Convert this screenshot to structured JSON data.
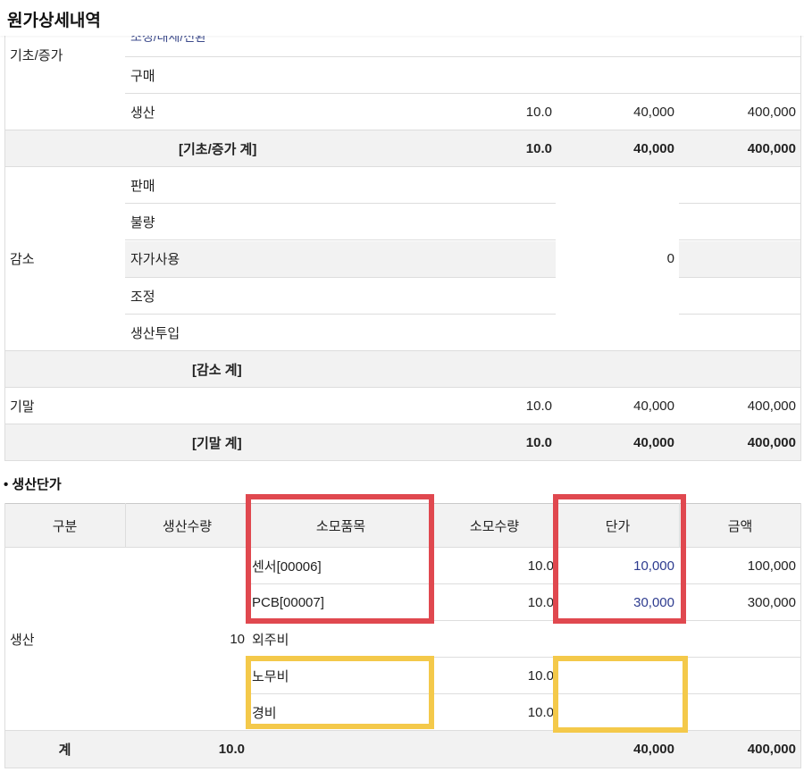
{
  "page": {
    "title": "원가상세내역",
    "peek_text": "조정/대체/전환"
  },
  "inventory": {
    "groups": {
      "basic": {
        "label": "기초/증가",
        "rows": [
          {
            "label": "구매",
            "qty": "",
            "price": "",
            "amount": ""
          },
          {
            "label": "생산",
            "qty": "10.0",
            "price": "40,000",
            "amount": "400,000"
          }
        ],
        "total": {
          "label": "[기초/증가 계]",
          "qty": "10.0",
          "price": "40,000",
          "amount": "400,000"
        }
      },
      "decrease": {
        "label": "감소",
        "rows": [
          "판매",
          "불량",
          "자가사용",
          "조정",
          "생산투입"
        ],
        "price": "0",
        "total": {
          "label": "[감소 계]"
        }
      },
      "ending": {
        "label": "기말",
        "qty": "10.0",
        "price": "40,000",
        "amount": "400,000",
        "total": {
          "label": "[기말 계]",
          "qty": "10.0",
          "price": "40,000",
          "amount": "400,000"
        }
      }
    }
  },
  "unit_cost": {
    "section_title": "• 생산단가",
    "headers": {
      "type": "구분",
      "prod_qty": "생산수량",
      "item": "소모품목",
      "consume_qty": "소모수량",
      "unit_price": "단가",
      "amount": "금액"
    },
    "type_label": "생산",
    "prod_qty": "10",
    "rows": [
      {
        "item": "센서[00006]",
        "qty": "10.0",
        "price": "10,000",
        "amount": "100,000"
      },
      {
        "item": "PCB[00007]",
        "qty": "10.0",
        "price": "30,000",
        "amount": "300,000"
      },
      {
        "item": "외주비",
        "qty": "",
        "price": "",
        "amount": ""
      },
      {
        "item": "노무비",
        "qty": "10.0",
        "price": "",
        "amount": ""
      },
      {
        "item": "경비",
        "qty": "10.0",
        "price": "",
        "amount": ""
      }
    ],
    "total": {
      "label": "계",
      "prod_qty": "10.0",
      "price": "40,000",
      "amount": "400,000"
    }
  },
  "colors": {
    "highlight_red": "#e0484f",
    "highlight_yellow": "#f4c94a",
    "link_blue": "#2d3b8f",
    "row_gray": "#f2f2f2"
  }
}
